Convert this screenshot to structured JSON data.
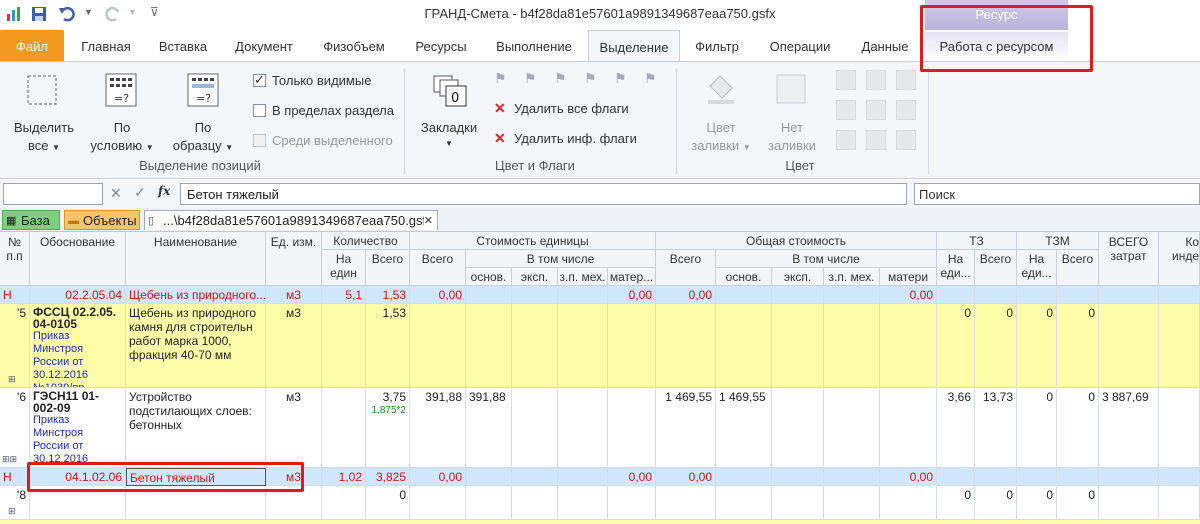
{
  "app_title": "ГРАНД-Смета - b4f28da81e57601a9891349687eaa750.gsfx",
  "context_header": "Ресурс",
  "tabs": [
    "Файл",
    "Главная",
    "Вставка",
    "Документ",
    "Физобъем",
    "Ресурсы",
    "Выполнение",
    "Выделение",
    "Фильтр",
    "Операции",
    "Данные"
  ],
  "context_tab": "Работа с ресурсом",
  "ribbon": {
    "select_all": [
      "Выделить",
      "все"
    ],
    "by_condition": [
      "По",
      "условию"
    ],
    "by_sample": [
      "По",
      "образцу"
    ],
    "only_visible": "Только видимые",
    "within_section": "В пределах раздела",
    "among_selected": "Среди выделенного",
    "group_selection": "Выделение позиций",
    "bookmarks": "Закладки",
    "delete_all_flags": "Удалить все флаги",
    "delete_inf_flags": "Удалить инф. флаги",
    "group_color_flags": "Цвет и Флаги",
    "fill_color": [
      "Цвет",
      "заливки"
    ],
    "no_fill": [
      "Нет",
      "заливки"
    ],
    "group_color": "Цвет"
  },
  "formula_bar": {
    "fx": "fx",
    "value": "Бетон тяжелый",
    "search_placeholder": "Поиск"
  },
  "sheet_tabs": [
    "База",
    "Объекты",
    "...\\b4f28da81e57601a9891349687eaa750.gsfx"
  ],
  "headers": {
    "num": "№ п.п",
    "basis": "Обоснование",
    "name": "Наименование",
    "unit": "Ед. изм.",
    "qty": "Количество",
    "qty_per": "На един",
    "qty_total": "Всего",
    "unit_cost": "Стоимость единицы",
    "uc_total": "Всего",
    "uc_incl": "В том числе",
    "uc_osn": "основ.",
    "uc_eksp": "эксп.",
    "uc_zpmeh": "з.п. мех.",
    "uc_mater": "матер...",
    "total_cost": "Общая стоимость",
    "tc_total": "Всего",
    "tc_incl": "В том числе",
    "tc_osn": "основ.",
    "tc_eksp": "эксп.",
    "tc_zpmeh": "з.п. мех.",
    "tc_mater": "матери",
    "tz": "ТЗ",
    "tz_per": "На еди...",
    "tz_total": "Всего",
    "tzm": "ТЗМ",
    "tzm_per": "На еди...",
    "tzm_total": "Всего",
    "all_costs": "ВСЕГО затрат",
    "koef": "Ко инде"
  },
  "rows": [
    {
      "num": "Н",
      "basis": "02.2.05.04",
      "name": "Щебень из природного...",
      "unit": "м3",
      "qty_per": "5,1",
      "qty_total": "1,53",
      "uc_total": "0,00",
      "uc_mater": "0,00",
      "tc_total": "0,00",
      "tc_mater": "0,00"
    },
    {
      "num": "'5",
      "basis_bold": "ФССЦ 02.2.05.04-0105",
      "basis_note": "Приказ Минстроя России от 30.12.2016 №1039/пр",
      "name": "Щебень из природного камня для строительн работ марка 1000, фракция 40-70 мм",
      "unit": "м3",
      "qty_total": "1,53",
      "tz_per": "0",
      "tz_total": "0",
      "tzm_per": "0",
      "tzm_total": "0"
    },
    {
      "num": "'6",
      "basis_bold": "ГЭСН11 01-002-09",
      "basis_note": "Приказ Минстроя России от 30.12.2016 №1038/пр",
      "name": "Устройство подстилающих слоев: бетонных",
      "unit": "м3",
      "qty_total": "3,75",
      "qty_formula": "1,875*2",
      "uc_total": "391,88",
      "uc_osn": "391,88",
      "tc_total": "1 469,55",
      "tc_osn": "1 469,55",
      "tz_per": "3,66",
      "tz_total": "13,73",
      "tzm_per": "0",
      "tzm_total": "0",
      "all_costs": "3 887,69"
    },
    {
      "num": "Н",
      "basis": "04.1.02.06",
      "name": "Бетон тяжелый",
      "unit": "м3",
      "qty_per": "1,02",
      "qty_total": "3,825",
      "uc_total": "0,00",
      "uc_mater": "0,00",
      "tc_total": "0,00",
      "tc_mater": "0,00"
    },
    {
      "num": "'8",
      "qty_total": "0",
      "tz_per": "0",
      "tz_total": "0",
      "tzm_per": "0",
      "tzm_total": "0"
    }
  ],
  "colors": {
    "file_tab": "#f39a1e",
    "yellow_row": "#fefea8",
    "blue_row": "#cfe6fb",
    "highlight_box": "#e01a1a",
    "context": "#b9b2dc"
  }
}
